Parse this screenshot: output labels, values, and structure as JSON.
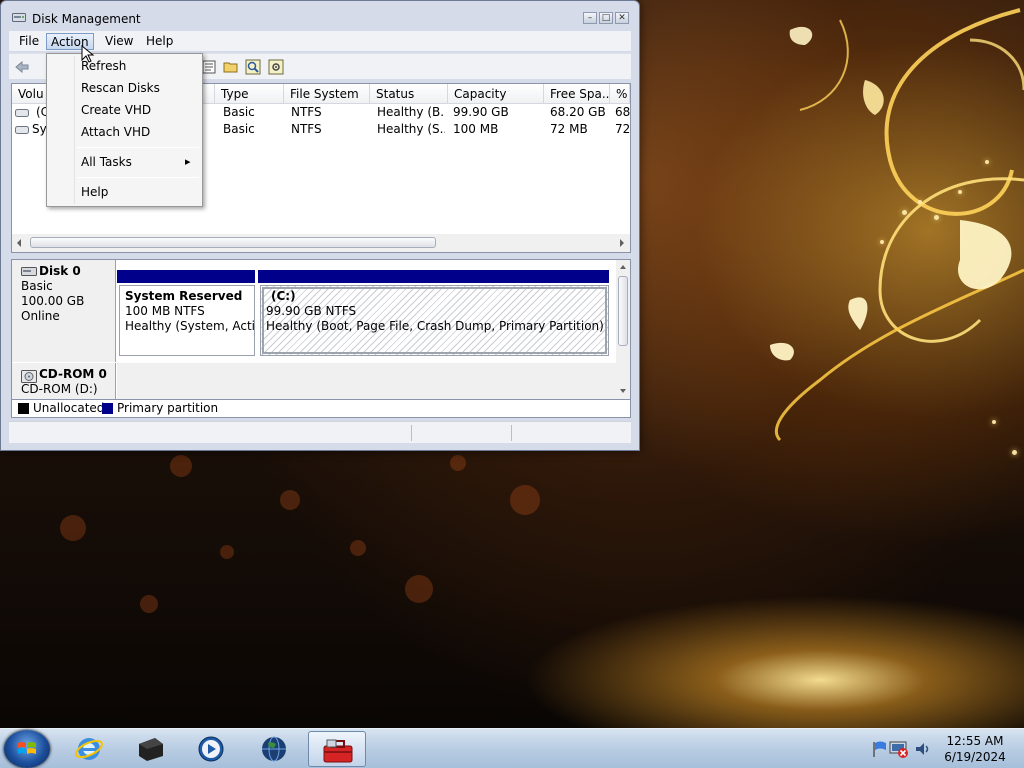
{
  "window": {
    "title": "Disk Management",
    "controls": {
      "minimize": "–",
      "maximize": "□",
      "close": "✕"
    }
  },
  "menubar": [
    "File",
    "Action",
    "View",
    "Help"
  ],
  "action_menu": {
    "items": [
      "Refresh",
      "Rescan Disks",
      "Create VHD",
      "Attach VHD"
    ],
    "all_tasks": "All Tasks",
    "submenu_arrow": "▸",
    "help": "Help"
  },
  "volume_list": {
    "columns": [
      "Volu",
      "Type",
      "File System",
      "Status",
      "Capacity",
      "Free Spa...",
      "%"
    ],
    "rows": [
      {
        "volume": "(C",
        "type": "Basic",
        "fs": "NTFS",
        "status": "Healthy (B...",
        "capacity": "99.90 GB",
        "free": "68.20 GB",
        "pct": "68"
      },
      {
        "volume": "Sys",
        "type": "Basic",
        "fs": "NTFS",
        "status": "Healthy (S...",
        "capacity": "100 MB",
        "free": "72 MB",
        "pct": "72"
      }
    ]
  },
  "disks": {
    "disk0": {
      "name": "Disk 0",
      "kind": "Basic",
      "size": "100.00 GB",
      "state": "Online"
    },
    "cdrom0": {
      "name": "CD-ROM 0",
      "drive": "CD-ROM (D:)"
    }
  },
  "partitions": {
    "system_reserved": {
      "name": "System Reserved",
      "size": "100 MB NTFS",
      "status": "Healthy (System, Active"
    },
    "c": {
      "name": "(C:)",
      "size": "99.90 GB NTFS",
      "status": "Healthy (Boot, Page File, Crash Dump, Primary Partition)"
    }
  },
  "legend": {
    "unallocated": "Unallocated",
    "primary": "Primary partition"
  },
  "clock": {
    "time": "12:55 AM",
    "date": "6/19/2024"
  },
  "colors": {
    "primary_partition": "#00008b",
    "unallocated": "#000000",
    "accent": "#1c4f9c"
  },
  "icons": {
    "toolbar": [
      "back-arrow-icon",
      "properties-icon",
      "open-folder-icon",
      "search-icon",
      "settings-icon"
    ],
    "taskbar": [
      "internet-explorer-icon",
      "disk-drive-icon",
      "media-player-icon",
      "globe-icon",
      "toolbox-icon"
    ]
  }
}
